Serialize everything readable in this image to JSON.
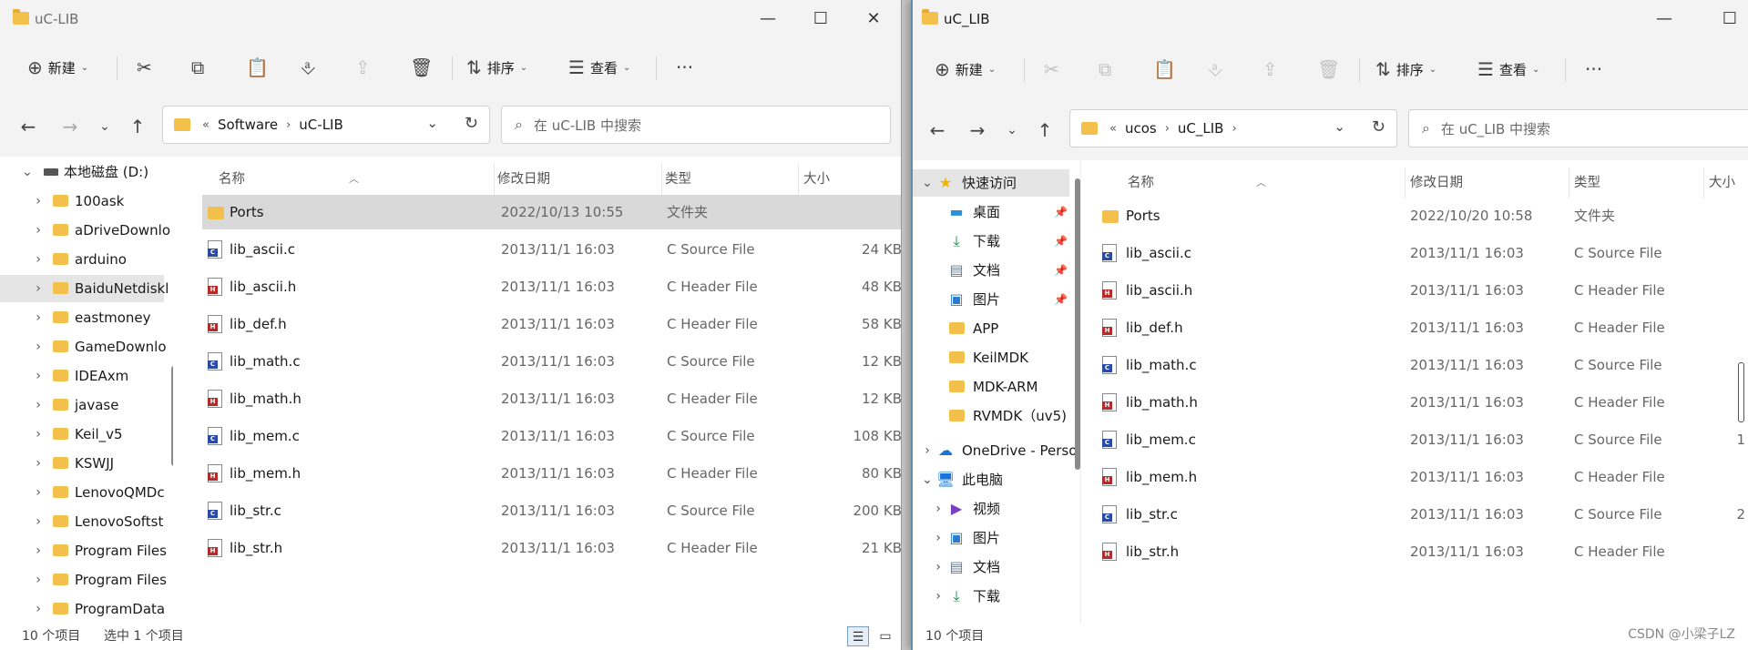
{
  "left": {
    "title": "uC-LIB",
    "controls": {
      "minimize": "—",
      "maximize": "☐",
      "close": "✕"
    },
    "toolbar": {
      "new_label": "新建",
      "sort_label": "排序",
      "view_label": "查看",
      "more": "···"
    },
    "nav": {
      "back": "←",
      "forward": "→",
      "recent": "⌄",
      "up": "↑"
    },
    "address": {
      "overflow": "«",
      "crumbs": [
        "Software",
        "uC-LIB"
      ],
      "sep": "›",
      "dropdown": "⌄",
      "refresh": "↻"
    },
    "search_placeholder": "在 uC-LIB 中搜索",
    "sidebar": {
      "drive": "本地磁盘 (D:)",
      "items": [
        "100ask",
        "aDriveDownlo",
        "arduino",
        "BaiduNetdiskl",
        "eastmoney",
        "GameDownlo",
        "IDEAxm",
        "javase",
        "Keil_v5",
        "KSWJJ",
        "LenovoQMDc",
        "LenovoSoftst",
        "Program Files",
        "Program Files",
        "ProgramData"
      ]
    },
    "columns": {
      "name": "名称",
      "date": "修改日期",
      "type": "类型",
      "size": "大小"
    },
    "files": [
      {
        "name": "Ports",
        "date": "2022/10/13 10:55",
        "type": "文件夹",
        "size": "",
        "kind": "folder"
      },
      {
        "name": "lib_ascii.c",
        "date": "2013/11/1 16:03",
        "type": "C Source File",
        "size": "24 KB",
        "kind": "c"
      },
      {
        "name": "lib_ascii.h",
        "date": "2013/11/1 16:03",
        "type": "C Header File",
        "size": "48 KB",
        "kind": "h"
      },
      {
        "name": "lib_def.h",
        "date": "2013/11/1 16:03",
        "type": "C Header File",
        "size": "58 KB",
        "kind": "h"
      },
      {
        "name": "lib_math.c",
        "date": "2013/11/1 16:03",
        "type": "C Source File",
        "size": "12 KB",
        "kind": "c"
      },
      {
        "name": "lib_math.h",
        "date": "2013/11/1 16:03",
        "type": "C Header File",
        "size": "12 KB",
        "kind": "h"
      },
      {
        "name": "lib_mem.c",
        "date": "2013/11/1 16:03",
        "type": "C Source File",
        "size": "108 KB",
        "kind": "c"
      },
      {
        "name": "lib_mem.h",
        "date": "2013/11/1 16:03",
        "type": "C Header File",
        "size": "80 KB",
        "kind": "h"
      },
      {
        "name": "lib_str.c",
        "date": "2013/11/1 16:03",
        "type": "C Source File",
        "size": "200 KB",
        "kind": "c"
      },
      {
        "name": "lib_str.h",
        "date": "2013/11/1 16:03",
        "type": "C Header File",
        "size": "21 KB",
        "kind": "h"
      }
    ],
    "status": {
      "count": "10 个项目",
      "selected": "选中 1 个项目"
    }
  },
  "right": {
    "title": "uC_LIB",
    "controls": {
      "minimize": "—",
      "maximize": "☐"
    },
    "toolbar": {
      "new_label": "新建",
      "sort_label": "排序",
      "view_label": "查看",
      "more": "···"
    },
    "nav": {
      "back": "←",
      "forward": "→",
      "recent": "⌄",
      "up": "↑"
    },
    "address": {
      "overflow": "«",
      "crumbs": [
        "ucos",
        "uC_LIB"
      ],
      "sep": "›",
      "dropdown": "⌄",
      "refresh": "↻"
    },
    "search_placeholder": "在 uC_LIB 中搜索",
    "sidebar": {
      "quick_access": "快速访问",
      "quick_items": [
        {
          "label": "桌面",
          "icon": "desktop-icon",
          "pinned": true
        },
        {
          "label": "下载",
          "icon": "download-icon",
          "pinned": true
        },
        {
          "label": "文档",
          "icon": "documents-icon",
          "pinned": true
        },
        {
          "label": "图片",
          "icon": "pictures-icon",
          "pinned": true
        },
        {
          "label": "APP",
          "icon": "folder-icon",
          "pinned": false
        },
        {
          "label": "KeilMDK",
          "icon": "folder-icon",
          "pinned": false
        },
        {
          "label": "MDK-ARM",
          "icon": "folder-icon",
          "pinned": false
        },
        {
          "label": "RVMDK（uv5)",
          "icon": "folder-icon",
          "pinned": false
        }
      ],
      "onedrive": "OneDrive - Perso",
      "this_pc": "此电脑",
      "pc_items": [
        {
          "label": "视频",
          "icon": "videos-icon"
        },
        {
          "label": "图片",
          "icon": "pictures-icon"
        },
        {
          "label": "文档",
          "icon": "documents-icon"
        },
        {
          "label": "下载",
          "icon": "download-icon"
        }
      ]
    },
    "columns": {
      "name": "名称",
      "date": "修改日期",
      "type": "类型",
      "size": "大小"
    },
    "files": [
      {
        "name": "Ports",
        "date": "2022/10/20 10:58",
        "type": "文件夹",
        "size": "",
        "kind": "folder"
      },
      {
        "name": "lib_ascii.c",
        "date": "2013/11/1 16:03",
        "type": "C Source File",
        "size": "",
        "kind": "c"
      },
      {
        "name": "lib_ascii.h",
        "date": "2013/11/1 16:03",
        "type": "C Header File",
        "size": "",
        "kind": "h"
      },
      {
        "name": "lib_def.h",
        "date": "2013/11/1 16:03",
        "type": "C Header File",
        "size": "",
        "kind": "h"
      },
      {
        "name": "lib_math.c",
        "date": "2013/11/1 16:03",
        "type": "C Source File",
        "size": "",
        "kind": "c"
      },
      {
        "name": "lib_math.h",
        "date": "2013/11/1 16:03",
        "type": "C Header File",
        "size": "",
        "kind": "h"
      },
      {
        "name": "lib_mem.c",
        "date": "2013/11/1 16:03",
        "type": "C Source File",
        "size": "1",
        "kind": "c"
      },
      {
        "name": "lib_mem.h",
        "date": "2013/11/1 16:03",
        "type": "C Header File",
        "size": "",
        "kind": "h"
      },
      {
        "name": "lib_str.c",
        "date": "2013/11/1 16:03",
        "type": "C Source File",
        "size": "2",
        "kind": "c"
      },
      {
        "name": "lib_str.h",
        "date": "2013/11/1 16:03",
        "type": "C Header File",
        "size": "",
        "kind": "h"
      }
    ],
    "status": {
      "count": "10 个项目"
    }
  },
  "watermark": "CSDN @小梁子LZ"
}
